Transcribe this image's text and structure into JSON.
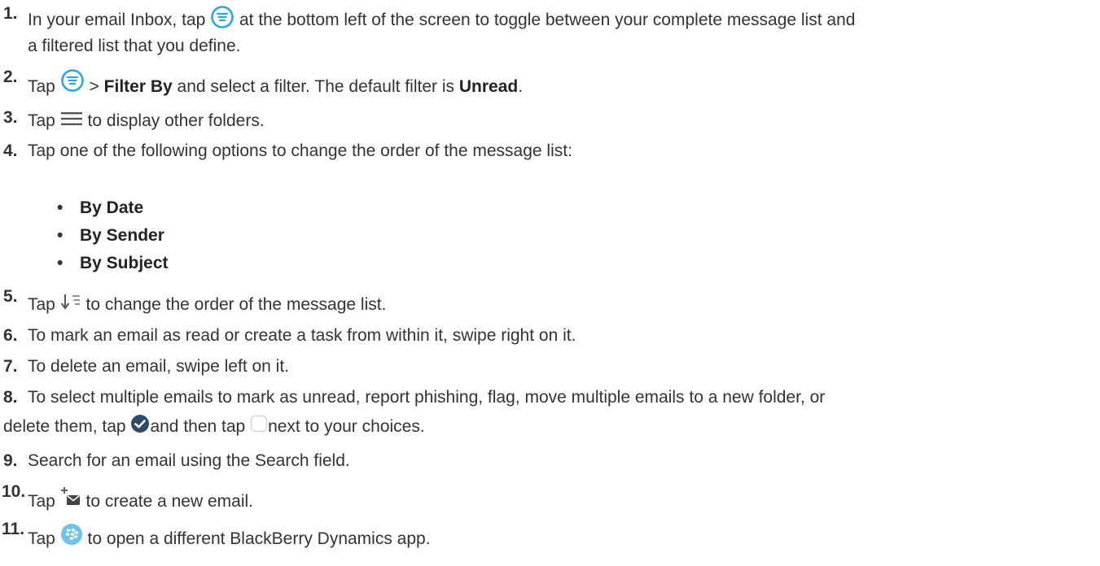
{
  "steps": [
    {
      "num": "1.",
      "a": "In your email Inbox, tap",
      "b": "at the bottom left of the screen to toggle between your complete message list and",
      "c": "a filtered list that you define."
    },
    {
      "num": "2.",
      "a": "Tap",
      "b": ">",
      "bold1": "Filter By",
      "c": "and select a filter. The default filter is",
      "bold2": "Unread",
      "d": "."
    },
    {
      "num": "3.",
      "a": "Tap",
      "b": "to display other folders."
    },
    {
      "num": "4.",
      "a": "Tap one of the following options to change the order of the message list:"
    },
    {
      "num": "5.",
      "a": "Tap",
      "b": "to change the order of the message list."
    },
    {
      "num": "6.",
      "a": "To mark an email as read or create a task from within it, swipe right on it."
    },
    {
      "num": "7.",
      "a": "To delete an email, swipe left on it."
    },
    {
      "num": "8.",
      "a": "To select multiple emails to mark as unread, report phishing, flag, move multiple emails to a new folder, or",
      "b": "delete them, tap",
      "c": "and then tap",
      "d": "next to your choices."
    },
    {
      "num": "9.",
      "a": "Search for an email using the Search field."
    },
    {
      "num": "10.",
      "a": "Tap",
      "b": "to create a new email."
    },
    {
      "num": "11.",
      "a": "Tap",
      "b": "to open a different BlackBerry Dynamics app."
    }
  ],
  "sort_options": [
    "By Date",
    "By Sender",
    "By Subject"
  ],
  "bullet_char": "•",
  "colors": {
    "filter_icon": "#29a8e0",
    "check_icon": "#2f4a6b",
    "blackberry_icon": "#6cc3ec",
    "text": "#333333"
  },
  "icons": [
    "filter-toggle-icon",
    "menu-icon",
    "sort-order-icon",
    "select-check-icon",
    "empty-checkbox-icon",
    "compose-email-icon",
    "blackberry-dynamics-icon"
  ]
}
